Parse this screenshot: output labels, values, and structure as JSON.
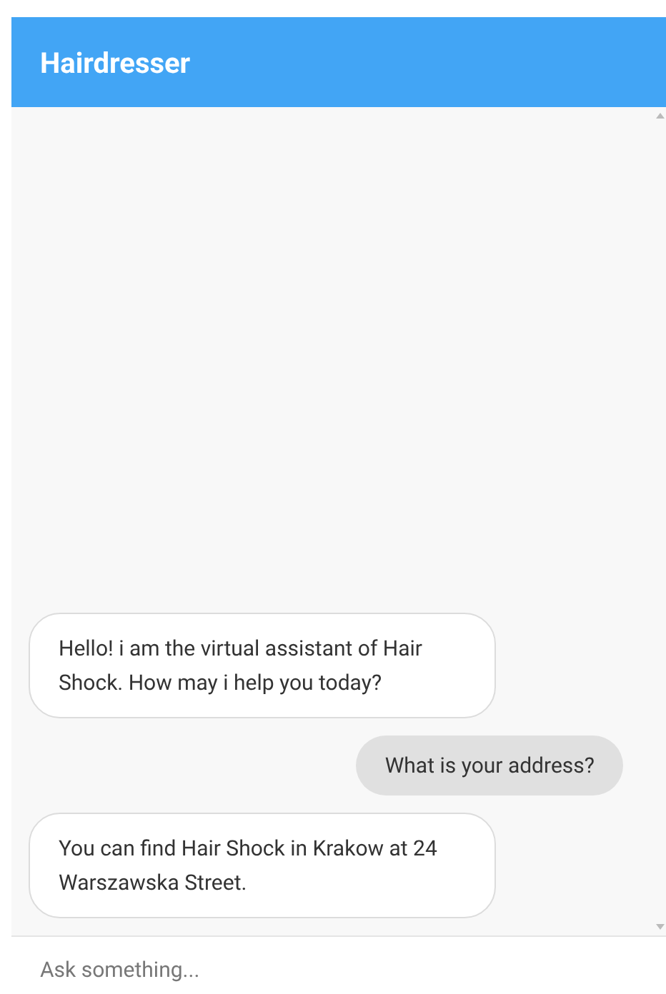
{
  "header": {
    "title": "Hairdresser"
  },
  "messages": [
    {
      "kind": "bot",
      "text": "Hello! i am the virtual assistant of Hair Shock. How may i help you today?"
    },
    {
      "kind": "user",
      "text": "What is your address?"
    },
    {
      "kind": "bot",
      "text": "You can find Hair Shock in Krakow at 24 Warszawska Street."
    }
  ],
  "input": {
    "placeholder": "Ask something..."
  }
}
